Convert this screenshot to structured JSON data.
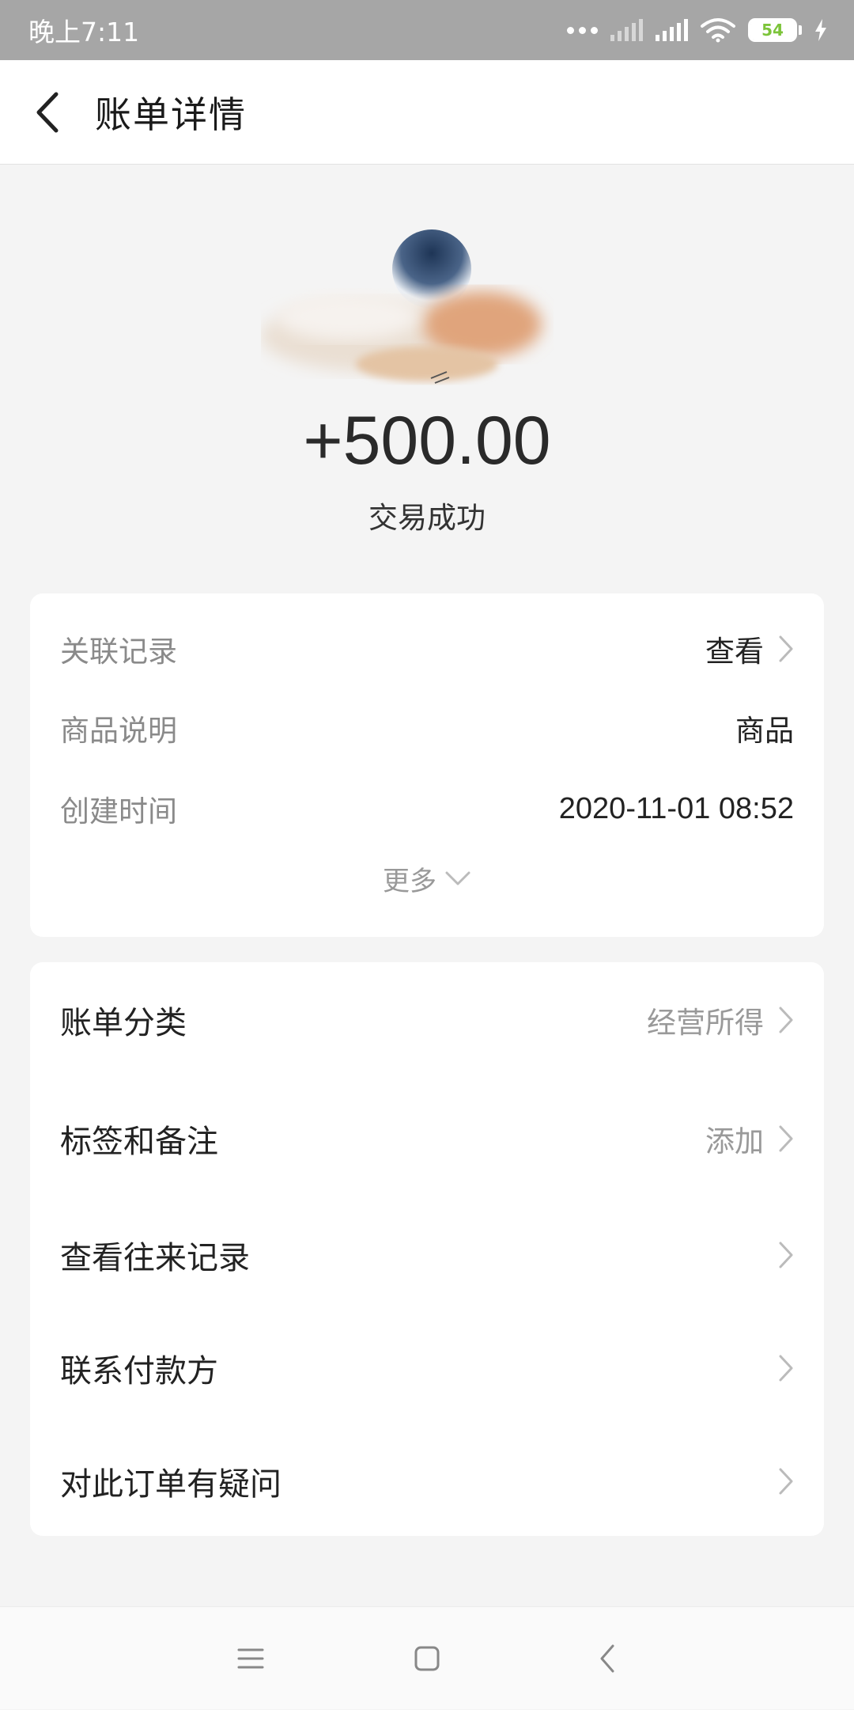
{
  "status_bar": {
    "time": "晚上7:11",
    "battery": "54"
  },
  "header": {
    "title": "账单详情"
  },
  "hero": {
    "amount": "+500.00",
    "status": "交易成功"
  },
  "details": {
    "rows": [
      {
        "label": "关联记录",
        "value": "查看"
      },
      {
        "label": "商品说明",
        "value": "商品"
      },
      {
        "label": "创建时间",
        "value": "2020-11-01 08:52"
      }
    ],
    "more": "更多"
  },
  "menu": {
    "items": [
      {
        "label": "账单分类",
        "value": "经营所得"
      },
      {
        "label": "标签和备注",
        "value": "添加"
      },
      {
        "label": "查看往来记录",
        "value": ""
      },
      {
        "label": "联系付款方",
        "value": ""
      },
      {
        "label": "对此订单有疑问",
        "value": ""
      }
    ]
  },
  "icons": {
    "back": "chevron-left-icon",
    "chevron": "chevron-right-icon",
    "more": "chevron-down-icon",
    "nav_menu": "menu-icon",
    "nav_home": "square-icon",
    "nav_back": "back-icon"
  }
}
